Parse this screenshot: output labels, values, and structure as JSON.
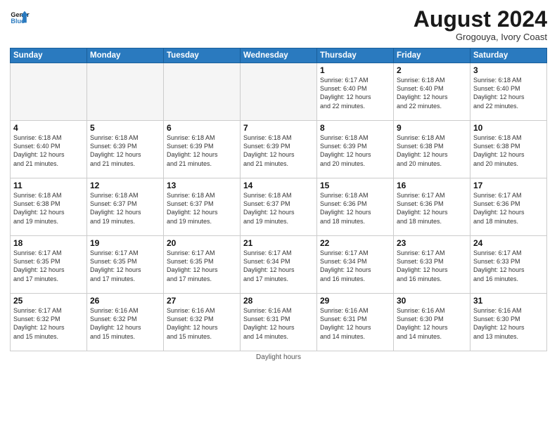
{
  "header": {
    "logo_line1": "General",
    "logo_line2": "Blue",
    "month_year": "August 2024",
    "location": "Grogouya, Ivory Coast"
  },
  "days_of_week": [
    "Sunday",
    "Monday",
    "Tuesday",
    "Wednesday",
    "Thursday",
    "Friday",
    "Saturday"
  ],
  "weeks": [
    [
      {
        "day": "",
        "info": ""
      },
      {
        "day": "",
        "info": ""
      },
      {
        "day": "",
        "info": ""
      },
      {
        "day": "",
        "info": ""
      },
      {
        "day": "1",
        "info": "Sunrise: 6:17 AM\nSunset: 6:40 PM\nDaylight: 12 hours\nand 22 minutes."
      },
      {
        "day": "2",
        "info": "Sunrise: 6:18 AM\nSunset: 6:40 PM\nDaylight: 12 hours\nand 22 minutes."
      },
      {
        "day": "3",
        "info": "Sunrise: 6:18 AM\nSunset: 6:40 PM\nDaylight: 12 hours\nand 22 minutes."
      }
    ],
    [
      {
        "day": "4",
        "info": "Sunrise: 6:18 AM\nSunset: 6:40 PM\nDaylight: 12 hours\nand 21 minutes."
      },
      {
        "day": "5",
        "info": "Sunrise: 6:18 AM\nSunset: 6:39 PM\nDaylight: 12 hours\nand 21 minutes."
      },
      {
        "day": "6",
        "info": "Sunrise: 6:18 AM\nSunset: 6:39 PM\nDaylight: 12 hours\nand 21 minutes."
      },
      {
        "day": "7",
        "info": "Sunrise: 6:18 AM\nSunset: 6:39 PM\nDaylight: 12 hours\nand 21 minutes."
      },
      {
        "day": "8",
        "info": "Sunrise: 6:18 AM\nSunset: 6:39 PM\nDaylight: 12 hours\nand 20 minutes."
      },
      {
        "day": "9",
        "info": "Sunrise: 6:18 AM\nSunset: 6:38 PM\nDaylight: 12 hours\nand 20 minutes."
      },
      {
        "day": "10",
        "info": "Sunrise: 6:18 AM\nSunset: 6:38 PM\nDaylight: 12 hours\nand 20 minutes."
      }
    ],
    [
      {
        "day": "11",
        "info": "Sunrise: 6:18 AM\nSunset: 6:38 PM\nDaylight: 12 hours\nand 19 minutes."
      },
      {
        "day": "12",
        "info": "Sunrise: 6:18 AM\nSunset: 6:37 PM\nDaylight: 12 hours\nand 19 minutes."
      },
      {
        "day": "13",
        "info": "Sunrise: 6:18 AM\nSunset: 6:37 PM\nDaylight: 12 hours\nand 19 minutes."
      },
      {
        "day": "14",
        "info": "Sunrise: 6:18 AM\nSunset: 6:37 PM\nDaylight: 12 hours\nand 19 minutes."
      },
      {
        "day": "15",
        "info": "Sunrise: 6:18 AM\nSunset: 6:36 PM\nDaylight: 12 hours\nand 18 minutes."
      },
      {
        "day": "16",
        "info": "Sunrise: 6:17 AM\nSunset: 6:36 PM\nDaylight: 12 hours\nand 18 minutes."
      },
      {
        "day": "17",
        "info": "Sunrise: 6:17 AM\nSunset: 6:36 PM\nDaylight: 12 hours\nand 18 minutes."
      }
    ],
    [
      {
        "day": "18",
        "info": "Sunrise: 6:17 AM\nSunset: 6:35 PM\nDaylight: 12 hours\nand 17 minutes."
      },
      {
        "day": "19",
        "info": "Sunrise: 6:17 AM\nSunset: 6:35 PM\nDaylight: 12 hours\nand 17 minutes."
      },
      {
        "day": "20",
        "info": "Sunrise: 6:17 AM\nSunset: 6:35 PM\nDaylight: 12 hours\nand 17 minutes."
      },
      {
        "day": "21",
        "info": "Sunrise: 6:17 AM\nSunset: 6:34 PM\nDaylight: 12 hours\nand 17 minutes."
      },
      {
        "day": "22",
        "info": "Sunrise: 6:17 AM\nSunset: 6:34 PM\nDaylight: 12 hours\nand 16 minutes."
      },
      {
        "day": "23",
        "info": "Sunrise: 6:17 AM\nSunset: 6:33 PM\nDaylight: 12 hours\nand 16 minutes."
      },
      {
        "day": "24",
        "info": "Sunrise: 6:17 AM\nSunset: 6:33 PM\nDaylight: 12 hours\nand 16 minutes."
      }
    ],
    [
      {
        "day": "25",
        "info": "Sunrise: 6:17 AM\nSunset: 6:32 PM\nDaylight: 12 hours\nand 15 minutes."
      },
      {
        "day": "26",
        "info": "Sunrise: 6:16 AM\nSunset: 6:32 PM\nDaylight: 12 hours\nand 15 minutes."
      },
      {
        "day": "27",
        "info": "Sunrise: 6:16 AM\nSunset: 6:32 PM\nDaylight: 12 hours\nand 15 minutes."
      },
      {
        "day": "28",
        "info": "Sunrise: 6:16 AM\nSunset: 6:31 PM\nDaylight: 12 hours\nand 14 minutes."
      },
      {
        "day": "29",
        "info": "Sunrise: 6:16 AM\nSunset: 6:31 PM\nDaylight: 12 hours\nand 14 minutes."
      },
      {
        "day": "30",
        "info": "Sunrise: 6:16 AM\nSunset: 6:30 PM\nDaylight: 12 hours\nand 14 minutes."
      },
      {
        "day": "31",
        "info": "Sunrise: 6:16 AM\nSunset: 6:30 PM\nDaylight: 12 hours\nand 13 minutes."
      }
    ]
  ],
  "footer": "Daylight hours"
}
